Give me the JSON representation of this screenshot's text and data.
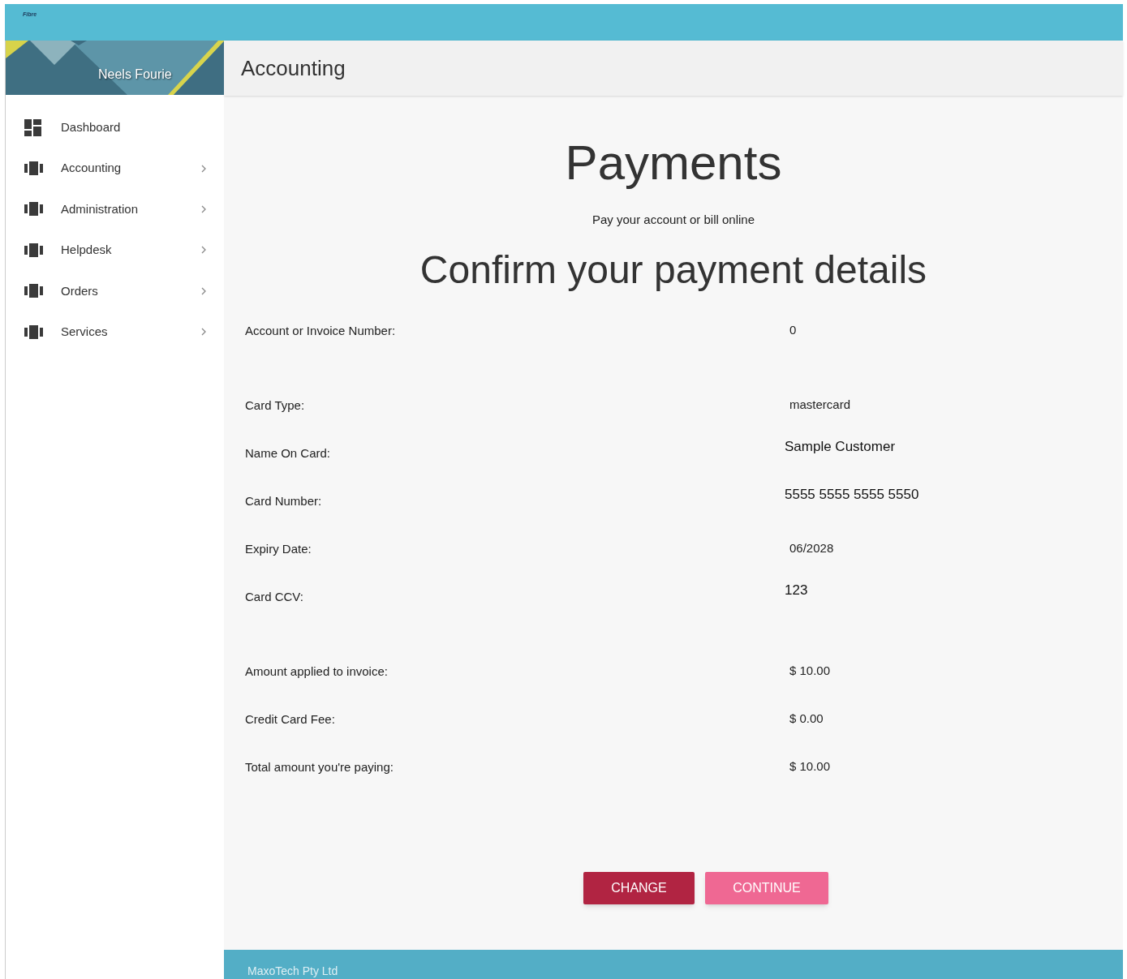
{
  "logo": {
    "text": "Fibre"
  },
  "sidebar": {
    "user_name": "Neels Fourie",
    "items": [
      {
        "label": "Dashboard",
        "kind": "dashboard",
        "expandable": false
      },
      {
        "label": "Accounting",
        "kind": "module",
        "expandable": true
      },
      {
        "label": "Administration",
        "kind": "module",
        "expandable": true
      },
      {
        "label": "Helpdesk",
        "kind": "module",
        "expandable": true
      },
      {
        "label": "Orders",
        "kind": "module",
        "expandable": true
      },
      {
        "label": "Services",
        "kind": "module",
        "expandable": true
      }
    ]
  },
  "page_header": {
    "title": "Accounting"
  },
  "content": {
    "title": "Payments",
    "subtitle": "Pay your account or bill online",
    "heading": "Confirm your payment details",
    "detail_groups": [
      {
        "rows": [
          {
            "label": "Account or Invoice Number:",
            "value": "0",
            "kind": "plain"
          }
        ]
      },
      {
        "rows": [
          {
            "label": "Card Type:",
            "value": "mastercard",
            "kind": "plain"
          },
          {
            "label": "Name On Card:",
            "value": "Sample Customer",
            "kind": "field"
          },
          {
            "label": "Card Number:",
            "value": "5555 5555 5555 5550",
            "kind": "field"
          },
          {
            "label": "Expiry Date:",
            "value": "06/2028",
            "kind": "plain"
          },
          {
            "label": "Card CCV:",
            "value": "123",
            "kind": "field"
          }
        ]
      },
      {
        "rows": [
          {
            "label": "Amount applied to invoice:",
            "value": "$ 10.00",
            "kind": "plain"
          },
          {
            "label": "Credit Card Fee:",
            "value": "$ 0.00",
            "kind": "plain"
          },
          {
            "label": "Total amount you're paying:",
            "value": "$ 10.00",
            "kind": "plain"
          }
        ]
      }
    ],
    "buttons": [
      {
        "label": "CHANGE",
        "kind": "secondary"
      },
      {
        "label": "CONTINUE",
        "kind": "primary"
      }
    ]
  },
  "footer": {
    "text": "MaxoTech Pty Ltd"
  }
}
